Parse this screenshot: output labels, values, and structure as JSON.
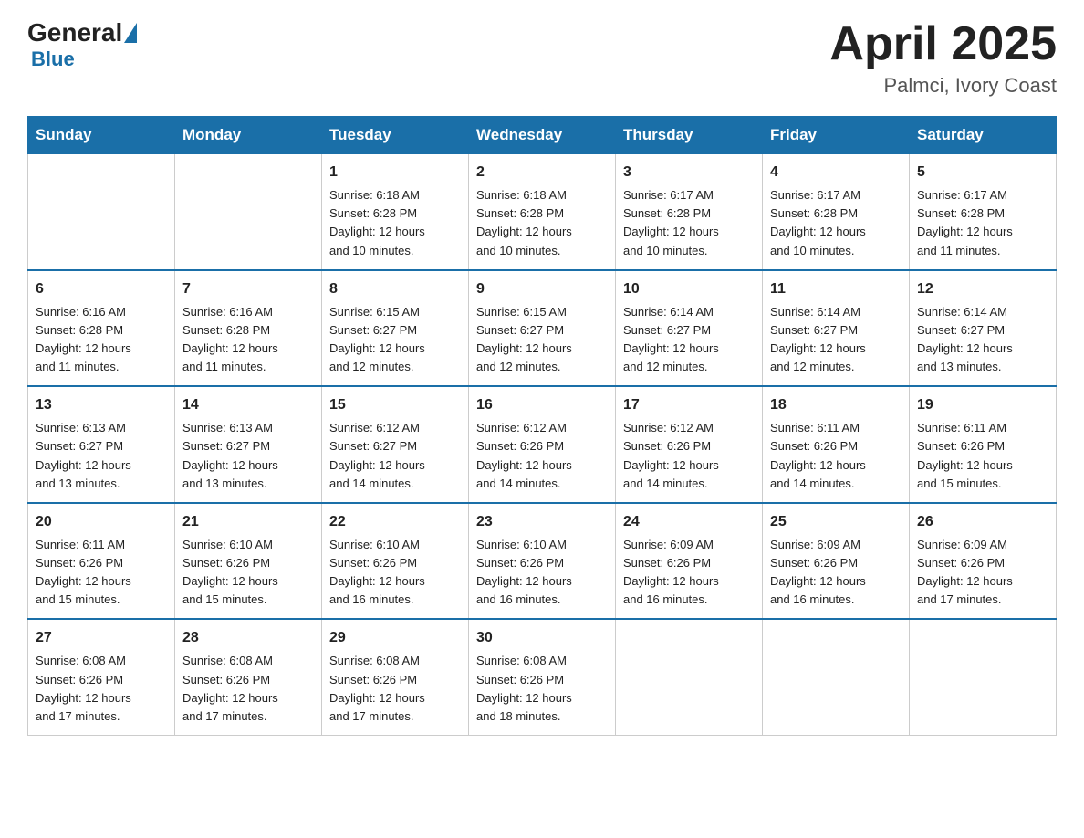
{
  "header": {
    "logo_general": "General",
    "logo_blue": "Blue",
    "month_year": "April 2025",
    "location": "Palmci, Ivory Coast"
  },
  "weekdays": [
    "Sunday",
    "Monday",
    "Tuesday",
    "Wednesday",
    "Thursday",
    "Friday",
    "Saturday"
  ],
  "weeks": [
    [
      {
        "day": "",
        "info": ""
      },
      {
        "day": "",
        "info": ""
      },
      {
        "day": "1",
        "info": "Sunrise: 6:18 AM\nSunset: 6:28 PM\nDaylight: 12 hours\nand 10 minutes."
      },
      {
        "day": "2",
        "info": "Sunrise: 6:18 AM\nSunset: 6:28 PM\nDaylight: 12 hours\nand 10 minutes."
      },
      {
        "day": "3",
        "info": "Sunrise: 6:17 AM\nSunset: 6:28 PM\nDaylight: 12 hours\nand 10 minutes."
      },
      {
        "day": "4",
        "info": "Sunrise: 6:17 AM\nSunset: 6:28 PM\nDaylight: 12 hours\nand 10 minutes."
      },
      {
        "day": "5",
        "info": "Sunrise: 6:17 AM\nSunset: 6:28 PM\nDaylight: 12 hours\nand 11 minutes."
      }
    ],
    [
      {
        "day": "6",
        "info": "Sunrise: 6:16 AM\nSunset: 6:28 PM\nDaylight: 12 hours\nand 11 minutes."
      },
      {
        "day": "7",
        "info": "Sunrise: 6:16 AM\nSunset: 6:28 PM\nDaylight: 12 hours\nand 11 minutes."
      },
      {
        "day": "8",
        "info": "Sunrise: 6:15 AM\nSunset: 6:27 PM\nDaylight: 12 hours\nand 12 minutes."
      },
      {
        "day": "9",
        "info": "Sunrise: 6:15 AM\nSunset: 6:27 PM\nDaylight: 12 hours\nand 12 minutes."
      },
      {
        "day": "10",
        "info": "Sunrise: 6:14 AM\nSunset: 6:27 PM\nDaylight: 12 hours\nand 12 minutes."
      },
      {
        "day": "11",
        "info": "Sunrise: 6:14 AM\nSunset: 6:27 PM\nDaylight: 12 hours\nand 12 minutes."
      },
      {
        "day": "12",
        "info": "Sunrise: 6:14 AM\nSunset: 6:27 PM\nDaylight: 12 hours\nand 13 minutes."
      }
    ],
    [
      {
        "day": "13",
        "info": "Sunrise: 6:13 AM\nSunset: 6:27 PM\nDaylight: 12 hours\nand 13 minutes."
      },
      {
        "day": "14",
        "info": "Sunrise: 6:13 AM\nSunset: 6:27 PM\nDaylight: 12 hours\nand 13 minutes."
      },
      {
        "day": "15",
        "info": "Sunrise: 6:12 AM\nSunset: 6:27 PM\nDaylight: 12 hours\nand 14 minutes."
      },
      {
        "day": "16",
        "info": "Sunrise: 6:12 AM\nSunset: 6:26 PM\nDaylight: 12 hours\nand 14 minutes."
      },
      {
        "day": "17",
        "info": "Sunrise: 6:12 AM\nSunset: 6:26 PM\nDaylight: 12 hours\nand 14 minutes."
      },
      {
        "day": "18",
        "info": "Sunrise: 6:11 AM\nSunset: 6:26 PM\nDaylight: 12 hours\nand 14 minutes."
      },
      {
        "day": "19",
        "info": "Sunrise: 6:11 AM\nSunset: 6:26 PM\nDaylight: 12 hours\nand 15 minutes."
      }
    ],
    [
      {
        "day": "20",
        "info": "Sunrise: 6:11 AM\nSunset: 6:26 PM\nDaylight: 12 hours\nand 15 minutes."
      },
      {
        "day": "21",
        "info": "Sunrise: 6:10 AM\nSunset: 6:26 PM\nDaylight: 12 hours\nand 15 minutes."
      },
      {
        "day": "22",
        "info": "Sunrise: 6:10 AM\nSunset: 6:26 PM\nDaylight: 12 hours\nand 16 minutes."
      },
      {
        "day": "23",
        "info": "Sunrise: 6:10 AM\nSunset: 6:26 PM\nDaylight: 12 hours\nand 16 minutes."
      },
      {
        "day": "24",
        "info": "Sunrise: 6:09 AM\nSunset: 6:26 PM\nDaylight: 12 hours\nand 16 minutes."
      },
      {
        "day": "25",
        "info": "Sunrise: 6:09 AM\nSunset: 6:26 PM\nDaylight: 12 hours\nand 16 minutes."
      },
      {
        "day": "26",
        "info": "Sunrise: 6:09 AM\nSunset: 6:26 PM\nDaylight: 12 hours\nand 17 minutes."
      }
    ],
    [
      {
        "day": "27",
        "info": "Sunrise: 6:08 AM\nSunset: 6:26 PM\nDaylight: 12 hours\nand 17 minutes."
      },
      {
        "day": "28",
        "info": "Sunrise: 6:08 AM\nSunset: 6:26 PM\nDaylight: 12 hours\nand 17 minutes."
      },
      {
        "day": "29",
        "info": "Sunrise: 6:08 AM\nSunset: 6:26 PM\nDaylight: 12 hours\nand 17 minutes."
      },
      {
        "day": "30",
        "info": "Sunrise: 6:08 AM\nSunset: 6:26 PM\nDaylight: 12 hours\nand 18 minutes."
      },
      {
        "day": "",
        "info": ""
      },
      {
        "day": "",
        "info": ""
      },
      {
        "day": "",
        "info": ""
      }
    ]
  ]
}
